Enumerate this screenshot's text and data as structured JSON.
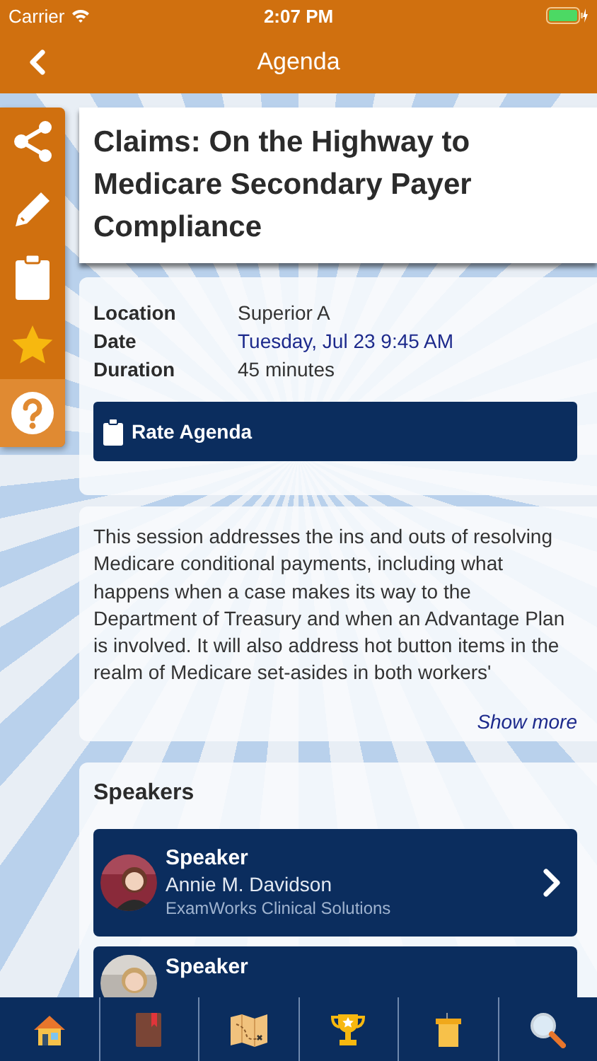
{
  "status_bar": {
    "carrier": "Carrier",
    "time": "2:07 PM"
  },
  "nav": {
    "title": "Agenda"
  },
  "session": {
    "title": "Claims: On the Highway to Medicare Secondary Payer Compliance"
  },
  "details": [
    {
      "label": "Location",
      "value": "Superior A",
      "link": false
    },
    {
      "label": "Date",
      "value": "Tuesday, Jul 23 9:45 AM",
      "link": true
    },
    {
      "label": "Duration",
      "value": "45 minutes",
      "link": false
    }
  ],
  "rate_button": {
    "label": "Rate Agenda"
  },
  "description": {
    "text": "This session addresses the ins and outs of resolving Medicare conditional payments, including what happens when a case makes its way to the Department of Treasury and when an Advantage Plan is involved. It will also address hot button items in the realm of Medicare set-asides in both workers'",
    "show_more": "Show more"
  },
  "speakers": {
    "heading": "Speakers",
    "items": [
      {
        "role": "Speaker",
        "name": "Annie M. Davidson",
        "organization": "ExamWorks Clinical Solutions"
      },
      {
        "role": "Speaker"
      }
    ]
  }
}
